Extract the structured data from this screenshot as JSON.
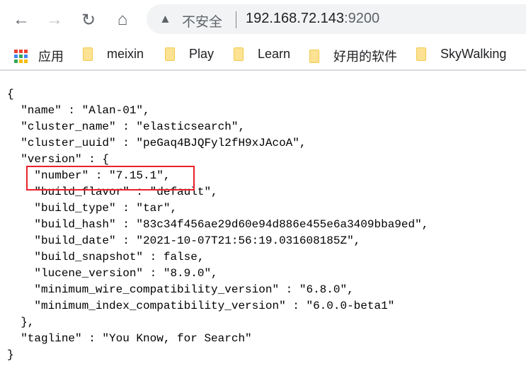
{
  "browser": {
    "security_label": "不安全",
    "url_host": "192.168.72.143",
    "url_port": ":9200"
  },
  "bookmarks": [
    {
      "label": "应用",
      "icon": "apps-grid-icon"
    },
    {
      "label": "meixin",
      "icon": "folder-icon"
    },
    {
      "label": "Play",
      "icon": "folder-icon"
    },
    {
      "label": "Learn",
      "icon": "folder-icon"
    },
    {
      "label": "好用的软件",
      "icon": "folder-icon"
    },
    {
      "label": "SkyWalking",
      "icon": "folder-icon"
    }
  ],
  "highlight_color": "#e8212b",
  "json_lines": [
    "{",
    "  \"name\" : \"Alan-01\",",
    "  \"cluster_name\" : \"elasticsearch\",",
    "  \"cluster_uuid\" : \"peGaq4BJQFyl2fH9xJAcoA\",",
    "  \"version\" : {",
    "    \"number\" : \"7.15.1\",",
    "    \"build_flavor\" : \"default\",",
    "    \"build_type\" : \"tar\",",
    "    \"build_hash\" : \"83c34f456ae29d60e94d886e455e6a3409bba9ed\",",
    "    \"build_date\" : \"2021-10-07T21:56:19.031608185Z\",",
    "    \"build_snapshot\" : false,",
    "    \"lucene_version\" : \"8.9.0\",",
    "    \"minimum_wire_compatibility_version\" : \"6.8.0\",",
    "    \"minimum_index_compatibility_version\" : \"6.0.0-beta1\"",
    "  },",
    "  \"tagline\" : \"You Know, for Search\"",
    "}"
  ]
}
